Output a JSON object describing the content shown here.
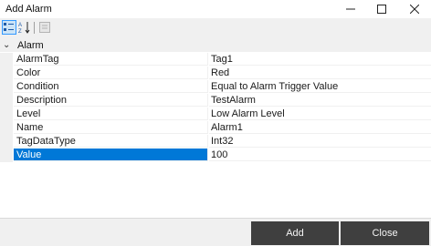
{
  "window": {
    "title": "Add Alarm"
  },
  "toolbar": {
    "categorized_icon": "categorized-icon",
    "alphabetical_icon": "sort-alphabetical-icon",
    "property_pages_icon": "property-pages-icon"
  },
  "category": {
    "label": "Alarm",
    "toggle": "⌄"
  },
  "properties": [
    {
      "name": "AlarmTag",
      "value": "Tag1"
    },
    {
      "name": "Color",
      "value": "Red"
    },
    {
      "name": "Condition",
      "value": "Equal to Alarm Trigger Value"
    },
    {
      "name": "Description",
      "value": "TestAlarm"
    },
    {
      "name": "Level",
      "value": "Low Alarm Level"
    },
    {
      "name": "Name",
      "value": "Alarm1"
    },
    {
      "name": "TagDataType",
      "value": "Int32"
    },
    {
      "name": "Value",
      "value": "100"
    }
  ],
  "footer": {
    "add_label": "Add",
    "close_label": "Close"
  },
  "colors": {
    "selection": "#0078d7",
    "button_bg": "#3f3f3f",
    "panel_bg": "#f0f0f0"
  }
}
